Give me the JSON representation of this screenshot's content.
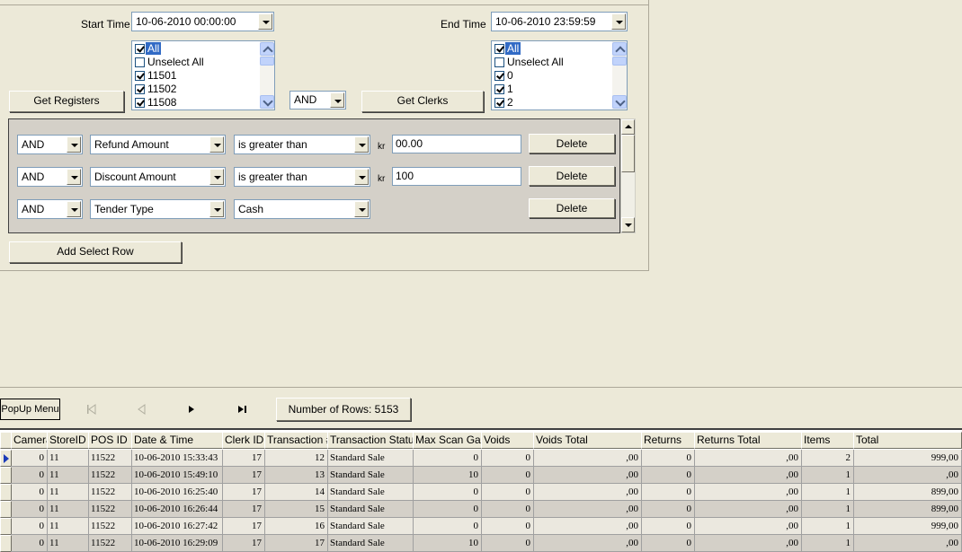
{
  "filters": {
    "start_time_label": "Start Time",
    "start_time_value": "10-06-2010 00:00:00",
    "end_time_label": "End Time",
    "end_time_value": "10-06-2010 23:59:59",
    "registers": {
      "button": "Get Registers",
      "items": [
        {
          "label": "All",
          "checked": true,
          "selected": true
        },
        {
          "label": "Unselect All",
          "checked": false,
          "selected": false
        },
        {
          "label": "11501",
          "checked": true,
          "selected": false
        },
        {
          "label": "11502",
          "checked": true,
          "selected": false
        },
        {
          "label": "11508",
          "checked": true,
          "selected": false
        }
      ]
    },
    "operator_value": "AND",
    "clerks": {
      "button": "Get Clerks",
      "items": [
        {
          "label": "All",
          "checked": true,
          "selected": true
        },
        {
          "label": "Unselect All",
          "checked": false,
          "selected": false
        },
        {
          "label": "0",
          "checked": true,
          "selected": false
        },
        {
          "label": "1",
          "checked": true,
          "selected": false
        },
        {
          "label": "2",
          "checked": true,
          "selected": false
        }
      ]
    }
  },
  "criteria": {
    "currency_label": "kr",
    "delete_label": "Delete",
    "rows": [
      {
        "logic": "AND",
        "field": "Refund Amount",
        "operator": "is greater than",
        "value": "00.00"
      },
      {
        "logic": "AND",
        "field": "Discount Amount",
        "operator": "is greater than",
        "value": "100"
      },
      {
        "logic": "AND",
        "field": "Tender Type",
        "operator": "Cash"
      }
    ],
    "add_button": "Add Select Row"
  },
  "navigator": {
    "popup_button": "PopUp Menu",
    "first_icon": "first-record-icon",
    "prev_icon": "previous-record-icon",
    "next_icon": "next-record-icon",
    "last_icon": "last-record-icon",
    "row_count_label": "Number of Rows: 5153"
  },
  "grid": {
    "columns": [
      "Camera",
      "StoreID",
      "POS ID",
      "Date & Time",
      "Clerk ID",
      "Transaction #",
      "Transaction Status",
      "Max Scan Gap",
      "Voids",
      "Voids Total",
      "Returns",
      "Returns Total",
      "Items",
      "Total"
    ],
    "rows": [
      [
        "0",
        "11",
        "11522",
        "10-06-2010 15:33:43",
        "17",
        "12",
        "Standard Sale",
        "0",
        "0",
        ",00",
        "0",
        ",00",
        "2",
        "999,00"
      ],
      [
        "0",
        "11",
        "11522",
        "10-06-2010 15:49:10",
        "17",
        "13",
        "Standard Sale",
        "10",
        "0",
        ",00",
        "0",
        ",00",
        "1",
        ",00"
      ],
      [
        "0",
        "11",
        "11522",
        "10-06-2010 16:25:40",
        "17",
        "14",
        "Standard Sale",
        "0",
        "0",
        ",00",
        "0",
        ",00",
        "1",
        "899,00"
      ],
      [
        "0",
        "11",
        "11522",
        "10-06-2010 16:26:44",
        "17",
        "15",
        "Standard Sale",
        "0",
        "0",
        ",00",
        "0",
        ",00",
        "1",
        "899,00"
      ],
      [
        "0",
        "11",
        "11522",
        "10-06-2010 16:27:42",
        "17",
        "16",
        "Standard Sale",
        "0",
        "0",
        ",00",
        "0",
        ",00",
        "1",
        "999,00"
      ],
      [
        "0",
        "11",
        "11522",
        "10-06-2010 16:29:09",
        "17",
        "17",
        "Standard Sale",
        "10",
        "0",
        ",00",
        "0",
        ",00",
        "1",
        ",00"
      ]
    ]
  },
  "colors": {
    "window_bg": "#ece9d8",
    "selection": "#316ac5",
    "row_alt": "#d4d0c8"
  }
}
